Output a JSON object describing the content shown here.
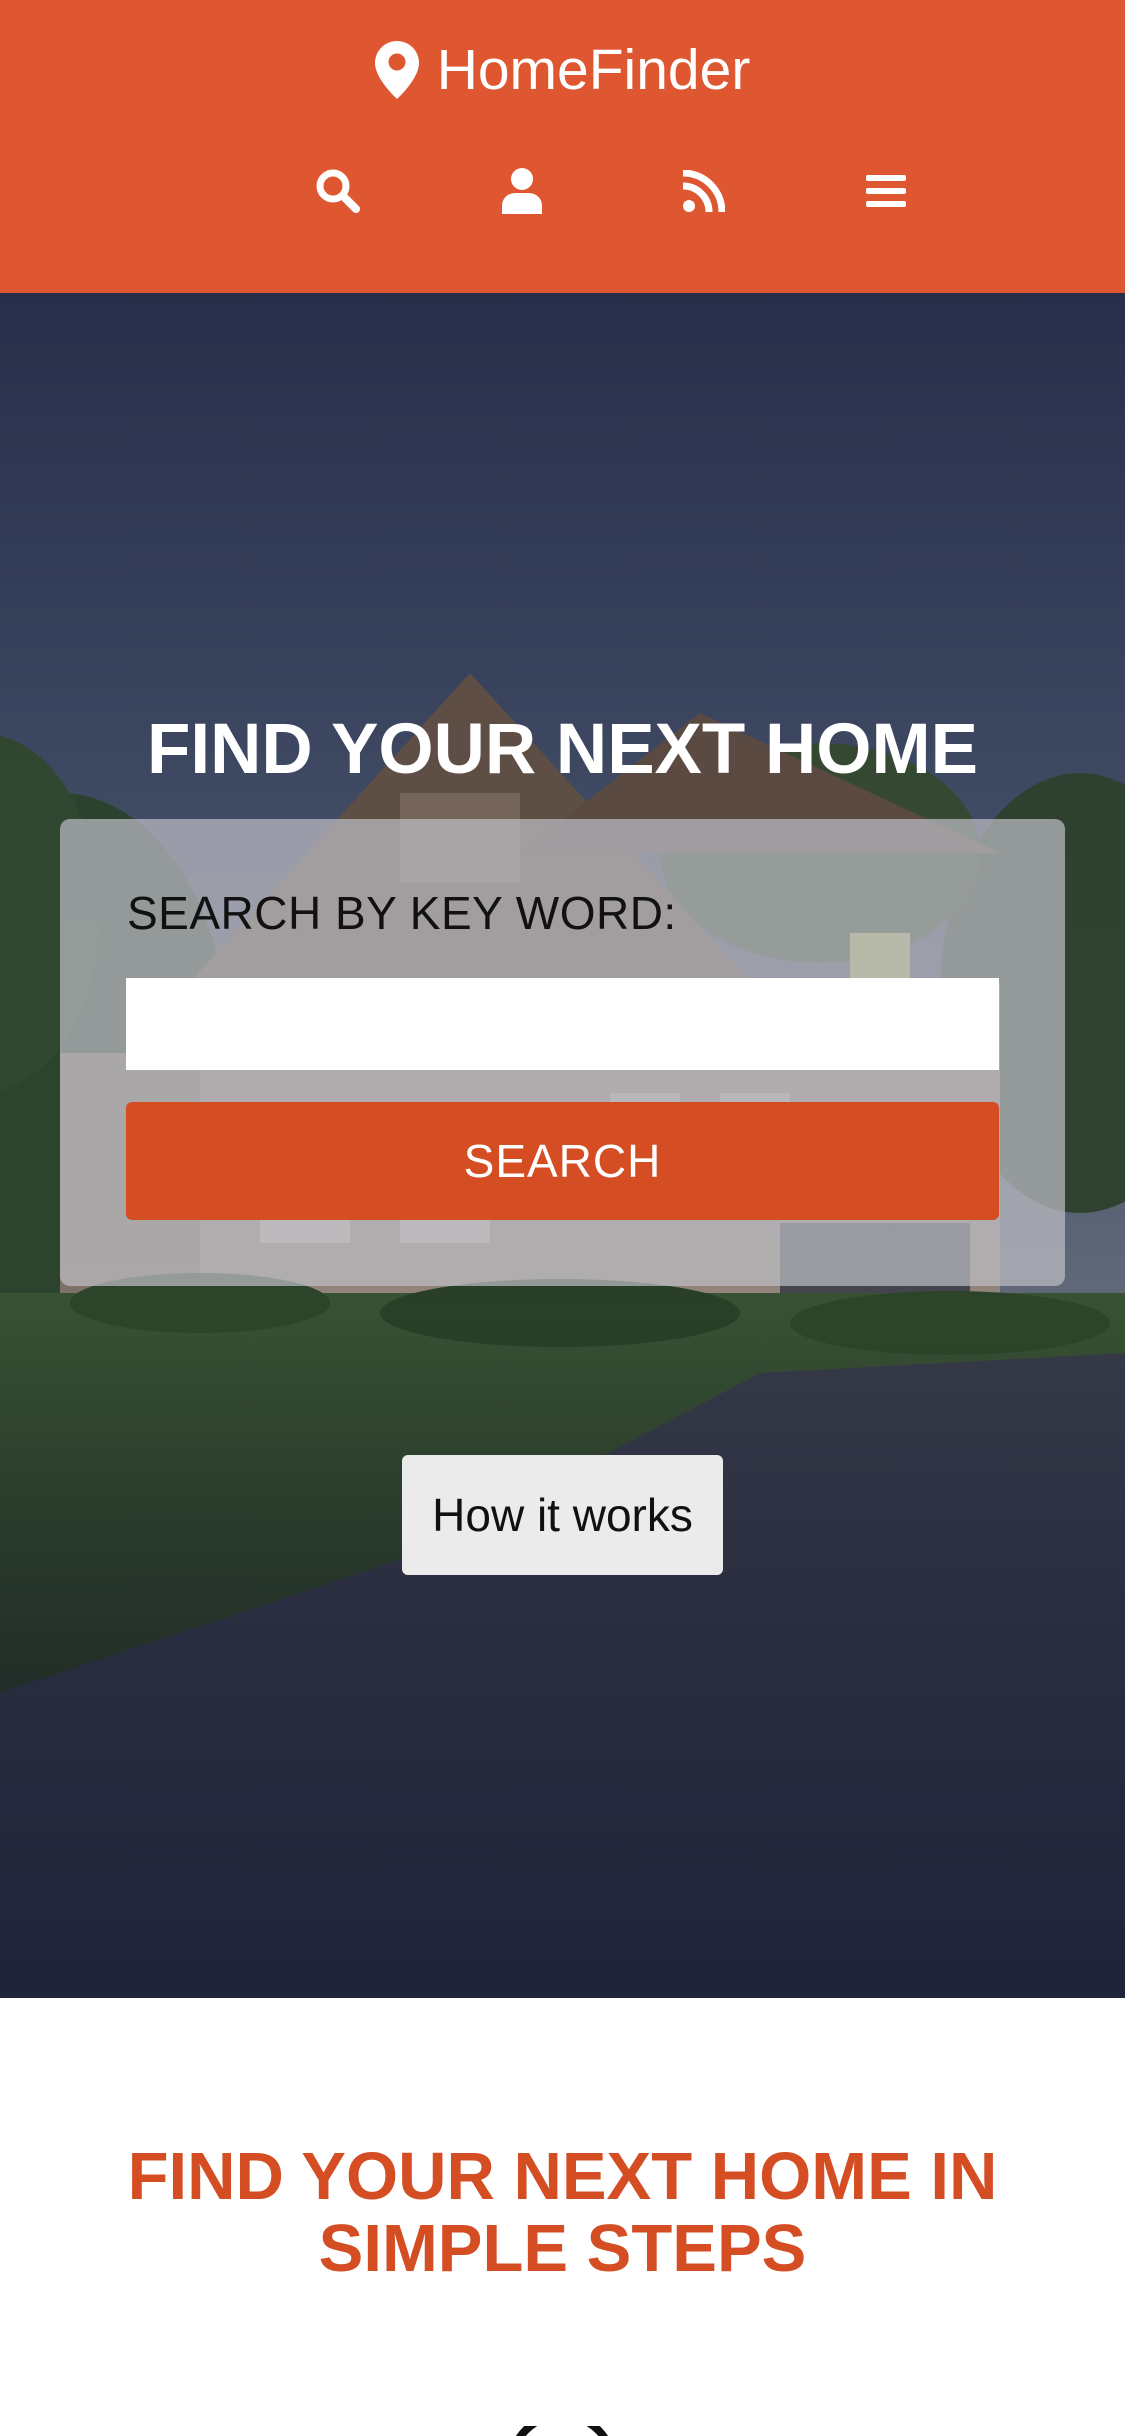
{
  "header": {
    "brand": "HomeFinder",
    "brand_icon": "map-marker-icon",
    "background": "#de5730",
    "nav": [
      {
        "icon": "search-icon",
        "label": "Search"
      },
      {
        "icon": "user-icon",
        "label": "Account"
      },
      {
        "icon": "rss-icon",
        "label": "Feed"
      },
      {
        "icon": "menu-icon",
        "label": "Menu"
      }
    ]
  },
  "hero": {
    "title": "FIND YOUR NEXT HOME",
    "search_label": "SEARCH BY KEY WORD:",
    "search_value": "",
    "search_button": "SEARCH",
    "how_button": "How it works"
  },
  "steps": {
    "title": "FIND YOUR NEXT HOME IN SIMPLE STEPS"
  },
  "colors": {
    "brand": "#de5730",
    "accent": "#d44d23",
    "text_dark": "#111111",
    "white": "#ffffff"
  }
}
